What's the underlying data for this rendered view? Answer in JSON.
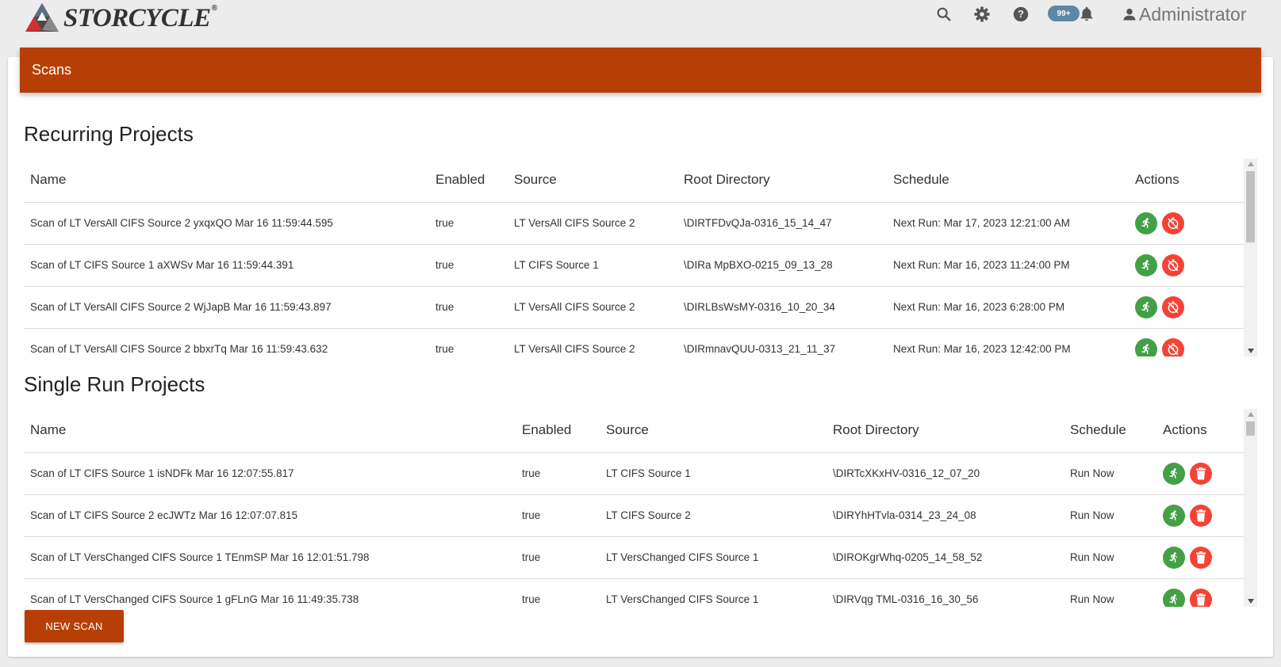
{
  "app": {
    "logo_text": "STORCYCLE",
    "logo_mark": "®"
  },
  "topbar": {
    "icons": [
      "search-icon",
      "gear-icon",
      "help-icon",
      "bell-icon",
      "person-icon"
    ],
    "notification_count": "99+",
    "user_name": "Administrator"
  },
  "page": {
    "header_title": "Scans",
    "accent_color": "#b73f05"
  },
  "recurring": {
    "title": "Recurring Projects",
    "columns": [
      "Name",
      "Enabled",
      "Source",
      "Root Directory",
      "Schedule",
      "Actions"
    ],
    "rows": [
      {
        "name": "Scan of LT VersAll CIFS Source 2 yxqxQO Mar 16 11:59:44.595",
        "enabled": "true",
        "source": "LT VersAll CIFS Source 2",
        "root": "\\DIRTFDvQJa-0316_15_14_47",
        "schedule": "Next Run: Mar 17, 2023 12:21:00 AM"
      },
      {
        "name": "Scan of LT CIFS Source 1 aXWSv Mar 16 11:59:44.391",
        "enabled": "true",
        "source": "LT CIFS Source 1",
        "root": "\\DIRa MpBXO-0215_09_13_28",
        "schedule": "Next Run: Mar 16, 2023 11:24:00 PM"
      },
      {
        "name": "Scan of LT VersAll CIFS Source 2 WjJapB Mar 16 11:59:43.897",
        "enabled": "true",
        "source": "LT VersAll CIFS Source 2",
        "root": "\\DIRLBsWsMY-0316_10_20_34",
        "schedule": "Next Run: Mar 16, 2023 6:28:00 PM"
      },
      {
        "name": "Scan of LT VersAll CIFS Source 2 bbxrTq Mar 16 11:59:43.632",
        "enabled": "true",
        "source": "LT VersAll CIFS Source 2",
        "root": "\\DIRmnavQUU-0313_21_11_37",
        "schedule": "Next Run: Mar 16, 2023 12:42:00 PM"
      }
    ],
    "row_actions": [
      "run-icon",
      "disable-schedule-icon"
    ]
  },
  "single": {
    "title": "Single Run Projects",
    "columns": [
      "Name",
      "Enabled",
      "Source",
      "Root Directory",
      "Schedule",
      "Actions"
    ],
    "rows": [
      {
        "name": "Scan of LT CIFS Source 1 isNDFk Mar 16 12:07:55.817",
        "enabled": "true",
        "source": "LT CIFS Source 1",
        "root": "\\DIRTcXKxHV-0316_12_07_20",
        "schedule": "Run Now"
      },
      {
        "name": "Scan of LT CIFS Source 2 ecJWTz Mar 16 12:07:07.815",
        "enabled": "true",
        "source": "LT CIFS Source 2",
        "root": "\\DIRYhHTvla-0314_23_24_08",
        "schedule": "Run Now"
      },
      {
        "name": "Scan of LT VersChanged CIFS Source 1 TEnmSP Mar 16 12:01:51.798",
        "enabled": "true",
        "source": "LT VersChanged CIFS Source 1",
        "root": "\\DIROKgrWhq-0205_14_58_52",
        "schedule": "Run Now"
      },
      {
        "name": "Scan of LT VersChanged CIFS Source 1 gFLnG Mar 16 11:49:35.738",
        "enabled": "true",
        "source": "LT VersChanged CIFS Source 1",
        "root": "\\DIRVqg TML-0316_16_30_56",
        "schedule": "Run Now"
      }
    ],
    "row_actions": [
      "run-icon",
      "delete-icon"
    ]
  },
  "footer": {
    "new_scan_label": "NEW SCAN"
  }
}
